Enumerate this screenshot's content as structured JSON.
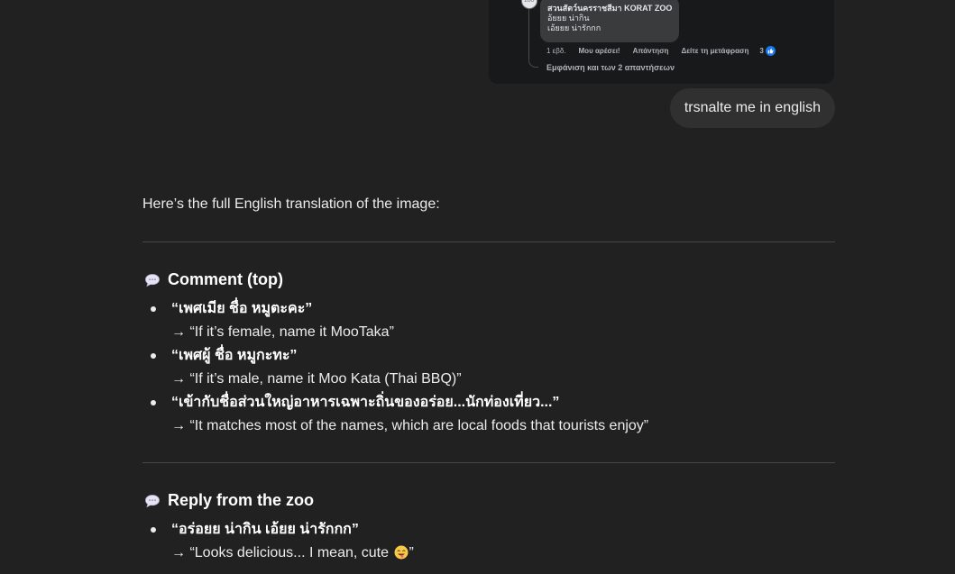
{
  "attachment": {
    "avatar_text": "ZOO",
    "reply_author": "สวนสัตว์นครราชสีมา KORAT ZOO",
    "reply_lines": [
      "อ้ยยย น่ากิน",
      "เอ้ยยย น่ารักกก"
    ],
    "actions": {
      "time": "1 εβδ.",
      "like": "Μου αρέσει!",
      "reply": "Απάντηση",
      "translate": "Δείτε τη μετάφραση",
      "reactions_count": "3"
    },
    "view_replies": "Εμφάνιση και των 2 απαντήσεων",
    "colors": {
      "background": "#18191a",
      "bubble": "#3a3b3c",
      "like_badge": "#1877f2"
    }
  },
  "user_message": "trsnalte me in english",
  "response": {
    "intro": "Here’s the full English translation of the image:",
    "sections": [
      {
        "icon": "speech-bubble-icon",
        "title": "Comment (top)",
        "items": [
          {
            "thai": "“เพศเมีย ชื่อ หมูตะคะ”",
            "english": "→ “If it’s female, name it MooTaka”"
          },
          {
            "thai": "“เพศผู้ ชื่อ หมูกะทะ”",
            "english": "→ “If it’s male, name it Moo Kata (Thai BBQ)”"
          },
          {
            "thai": "“เข้ากับชื่อส่วนใหญ่อาหารเฉพาะถิ่นของอร่อย...นักท่องเที่ยว...”",
            "english": "→ “It matches most of the names, which are local foods that tourists enjoy”"
          }
        ]
      },
      {
        "icon": "speech-bubble-icon",
        "title": "Reply from the zoo",
        "items": [
          {
            "thai": "“อร่อยย น่ากิน เอ้ยย น่ารักกก”",
            "english": "→ “Looks delicious... I mean, cute ”",
            "emoji": "face-savoring-food-icon"
          }
        ]
      }
    ]
  },
  "theme": {
    "background": "#212121",
    "user_bubble": "#303030",
    "divider": "#474747"
  }
}
